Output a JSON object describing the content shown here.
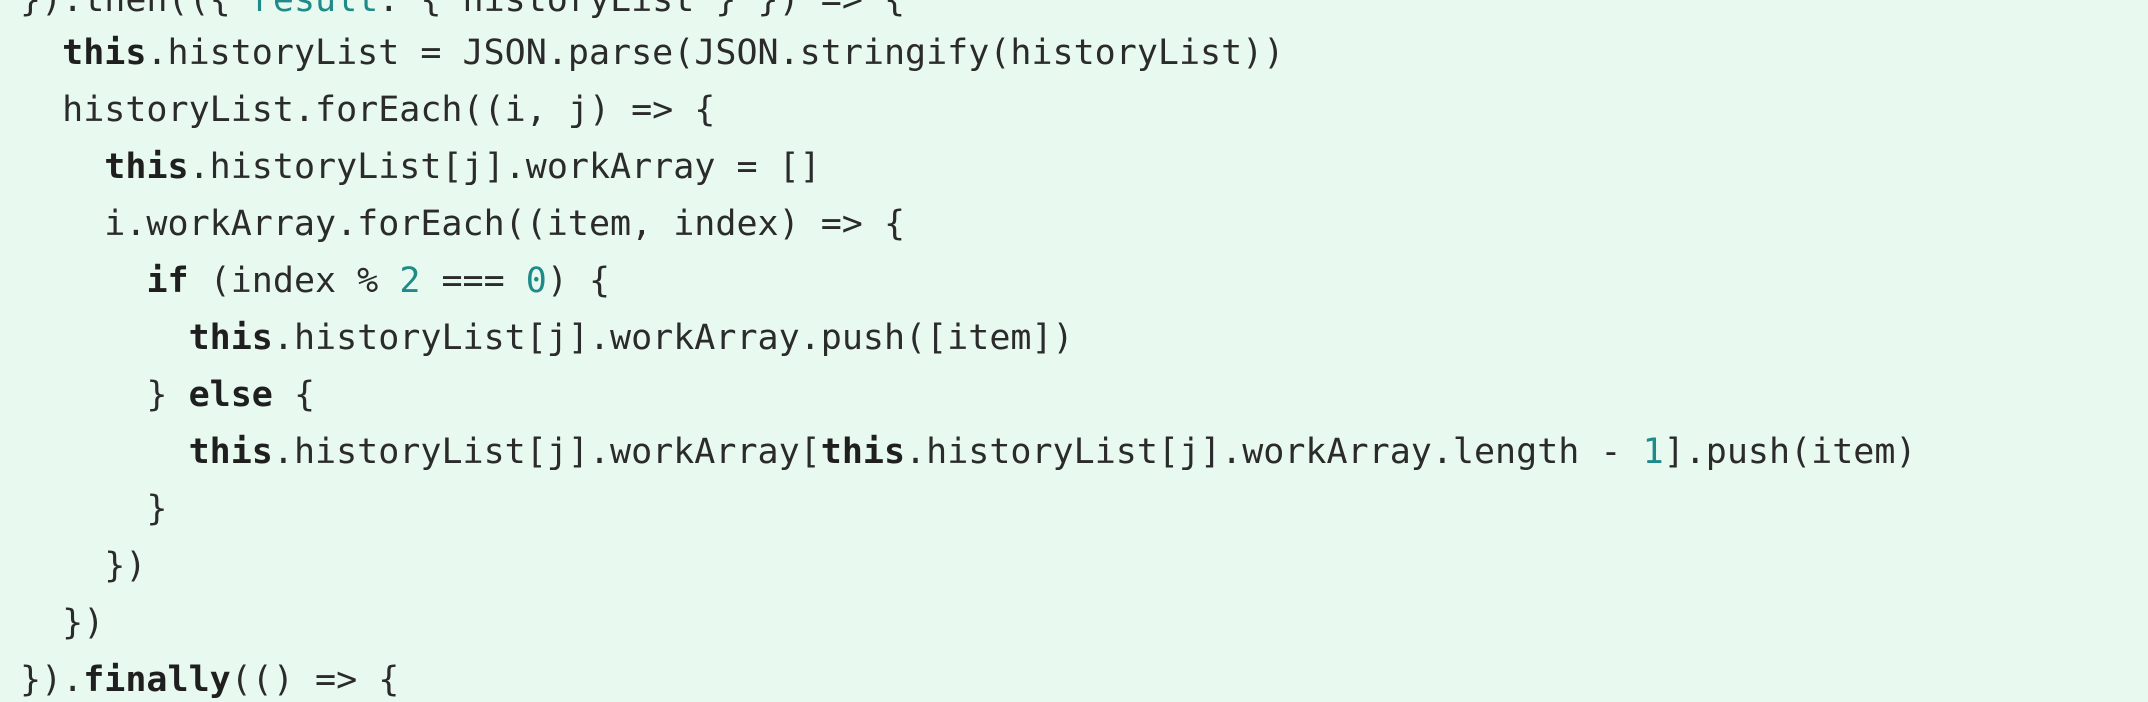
{
  "code": {
    "lines": [
      [
        {
          "t": "}).then(({ ",
          "k": "plain"
        },
        {
          "t": "result",
          "k": "prop"
        },
        {
          "t": ": { historyList } }) => {",
          "k": "plain"
        }
      ],
      [
        {
          "t": "  ",
          "k": "plain"
        },
        {
          "t": "this",
          "k": "kw"
        },
        {
          "t": ".historyList = JSON.parse(JSON.stringify(historyList))",
          "k": "plain"
        }
      ],
      [
        {
          "t": "  historyList.forEach((i, j) => {",
          "k": "plain"
        }
      ],
      [
        {
          "t": "    ",
          "k": "plain"
        },
        {
          "t": "this",
          "k": "kw"
        },
        {
          "t": ".historyList[j].workArray = []",
          "k": "plain"
        }
      ],
      [
        {
          "t": "    i.workArray.forEach((item, index) => {",
          "k": "plain"
        }
      ],
      [
        {
          "t": "      ",
          "k": "plain"
        },
        {
          "t": "if",
          "k": "kw"
        },
        {
          "t": " (index % ",
          "k": "plain"
        },
        {
          "t": "2",
          "k": "num"
        },
        {
          "t": " === ",
          "k": "plain"
        },
        {
          "t": "0",
          "k": "num"
        },
        {
          "t": ") {",
          "k": "plain"
        }
      ],
      [
        {
          "t": "        ",
          "k": "plain"
        },
        {
          "t": "this",
          "k": "kw"
        },
        {
          "t": ".historyList[j].workArray.push([item])",
          "k": "plain"
        }
      ],
      [
        {
          "t": "      } ",
          "k": "plain"
        },
        {
          "t": "else",
          "k": "kw"
        },
        {
          "t": " {",
          "k": "plain"
        }
      ],
      [
        {
          "t": "        ",
          "k": "plain"
        },
        {
          "t": "this",
          "k": "kw"
        },
        {
          "t": ".historyList[j].workArray[",
          "k": "plain"
        },
        {
          "t": "this",
          "k": "kw"
        },
        {
          "t": ".historyList[j].workArray.length - ",
          "k": "plain"
        },
        {
          "t": "1",
          "k": "num"
        },
        {
          "t": "].push(item)",
          "k": "plain"
        }
      ],
      [
        {
          "t": "      }",
          "k": "plain"
        }
      ],
      [
        {
          "t": "    })",
          "k": "plain"
        }
      ],
      [
        {
          "t": "  })",
          "k": "plain"
        }
      ],
      [
        {
          "t": "}).",
          "k": "plain"
        },
        {
          "t": "finally",
          "k": "kw"
        },
        {
          "t": "(() => {",
          "k": "plain"
        }
      ]
    ]
  },
  "colors": {
    "background": "#e8faf0",
    "text": "#2b2b2b",
    "number": "#1f8a8a",
    "keyword": "#1f1f1f"
  }
}
